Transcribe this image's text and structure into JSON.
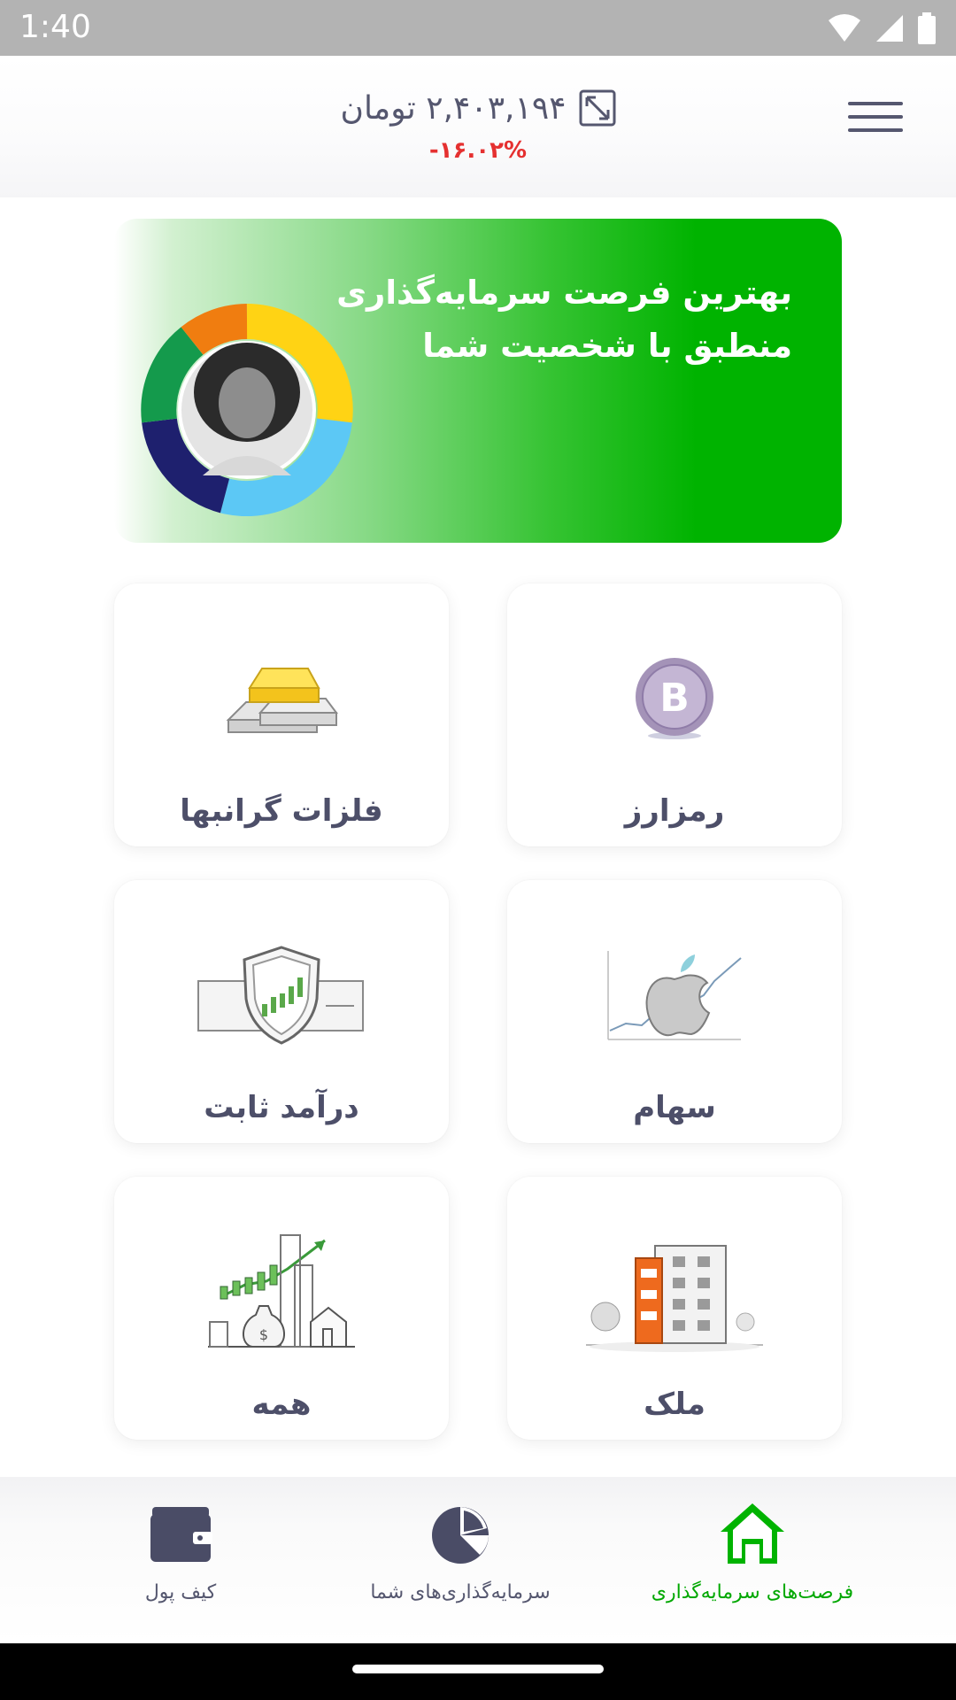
{
  "status_bar": {
    "time": "1:40"
  },
  "header": {
    "balance": "۲,۴۰۳,۱۹۴ تومان",
    "change": "-۱۶.۰۲%"
  },
  "banner": {
    "line1": "بهترین فرصت سرمایه‌گذاری",
    "line2": "منطبق با شخصیت شما"
  },
  "categories": [
    {
      "label": "رمزارز",
      "icon": "bitcoin-coin"
    },
    {
      "label": "فلزات گرانبها",
      "icon": "gold-bars"
    },
    {
      "label": "سهام",
      "icon": "apple-stock-chart"
    },
    {
      "label": "درآمد ثابت",
      "icon": "shield-bond"
    },
    {
      "label": "ملک",
      "icon": "building"
    },
    {
      "label": "همه",
      "icon": "all-investments"
    }
  ],
  "bottom_nav": [
    {
      "label": "فرصت‌های سرمایه‌گذاری",
      "icon": "home-icon",
      "active": true
    },
    {
      "label": "سرمایه‌گذاری‌های شما",
      "icon": "pie-chart-icon",
      "active": false
    },
    {
      "label": "کیف پول",
      "icon": "wallet-icon",
      "active": false
    }
  ],
  "colors": {
    "accent_green": "#00b300",
    "negative_red": "#e53030",
    "text_dark": "#4d4f69"
  }
}
